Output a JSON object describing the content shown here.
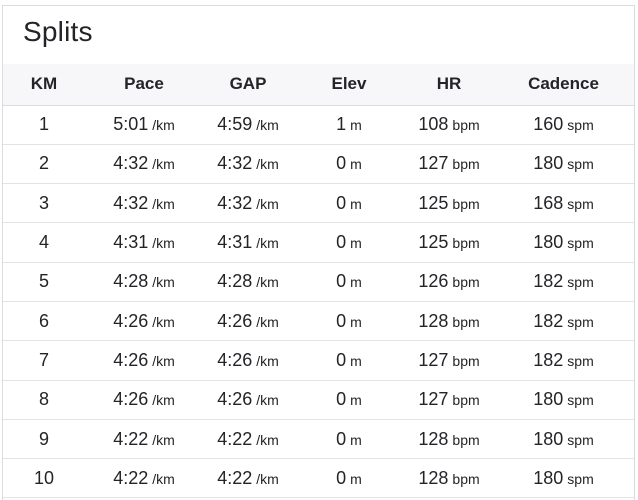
{
  "title": "Splits",
  "headers": {
    "km": "KM",
    "pace": "Pace",
    "gap": "GAP",
    "elev": "Elev",
    "hr": "HR",
    "cadence": "Cadence"
  },
  "units": {
    "pace": "/km",
    "gap": "/km",
    "elev": "m",
    "hr": "bpm",
    "cadence": "spm"
  },
  "rows": [
    {
      "km": "1",
      "pace": "5:01",
      "gap": "4:59",
      "elev": "1",
      "hr": "108",
      "cadence": "160"
    },
    {
      "km": "2",
      "pace": "4:32",
      "gap": "4:32",
      "elev": "0",
      "hr": "127",
      "cadence": "180"
    },
    {
      "km": "3",
      "pace": "4:32",
      "gap": "4:32",
      "elev": "0",
      "hr": "125",
      "cadence": "168"
    },
    {
      "km": "4",
      "pace": "4:31",
      "gap": "4:31",
      "elev": "0",
      "hr": "125",
      "cadence": "180"
    },
    {
      "km": "5",
      "pace": "4:28",
      "gap": "4:28",
      "elev": "0",
      "hr": "126",
      "cadence": "182"
    },
    {
      "km": "6",
      "pace": "4:26",
      "gap": "4:26",
      "elev": "0",
      "hr": "128",
      "cadence": "182"
    },
    {
      "km": "7",
      "pace": "4:26",
      "gap": "4:26",
      "elev": "0",
      "hr": "127",
      "cadence": "182"
    },
    {
      "km": "8",
      "pace": "4:26",
      "gap": "4:26",
      "elev": "0",
      "hr": "127",
      "cadence": "180"
    },
    {
      "km": "9",
      "pace": "4:22",
      "gap": "4:22",
      "elev": "0",
      "hr": "128",
      "cadence": "180"
    },
    {
      "km": "10",
      "pace": "4:22",
      "gap": "4:22",
      "elev": "0",
      "hr": "128",
      "cadence": "180"
    }
  ]
}
